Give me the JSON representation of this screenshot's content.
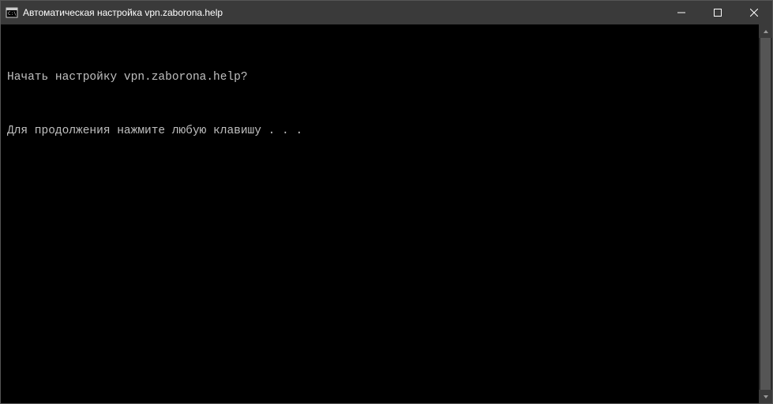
{
  "window": {
    "title": "Автоматическая настройка vpn.zaborona.help"
  },
  "terminal": {
    "line1": "Начать настройку vpn.zaborona.help?",
    "line2": "Для продолжения нажмите любую клавишу . . ."
  }
}
